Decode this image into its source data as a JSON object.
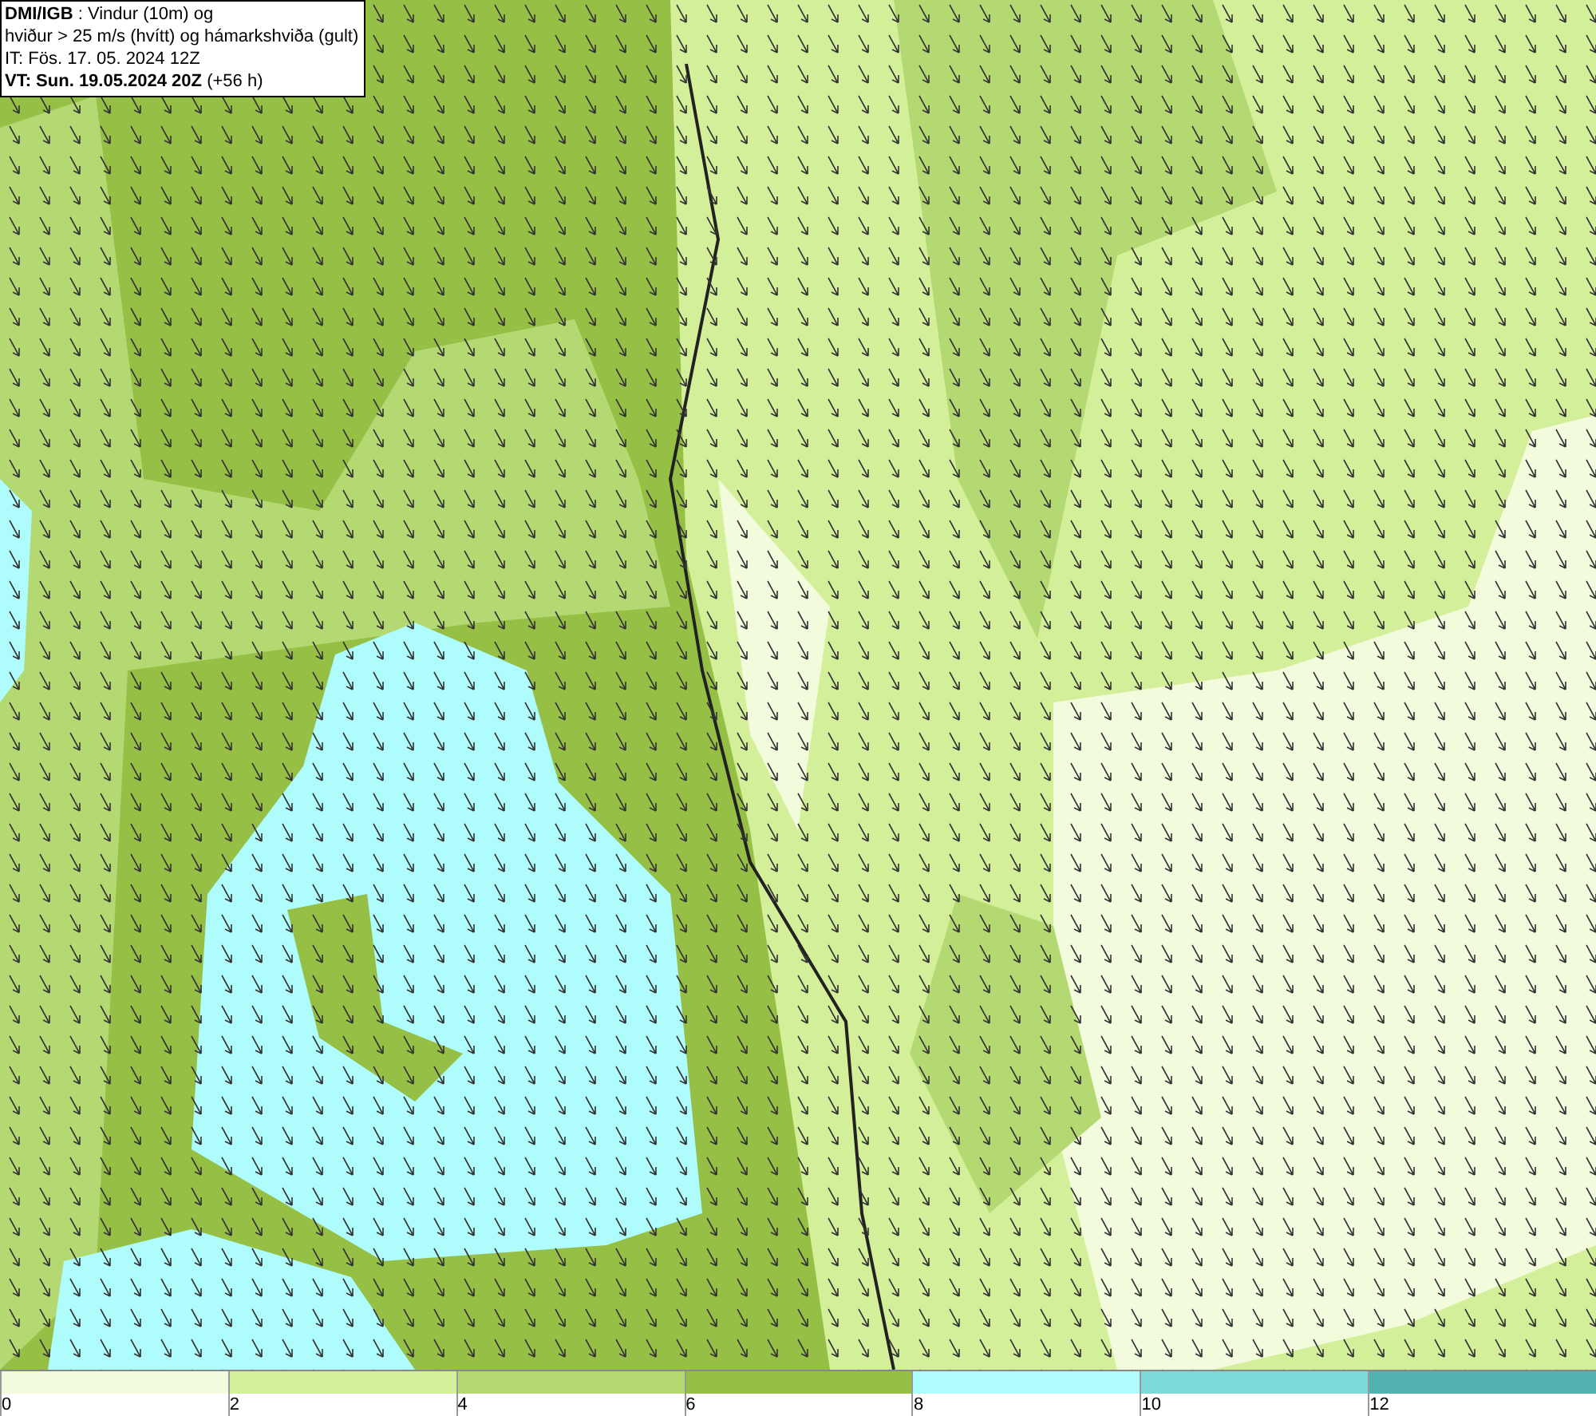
{
  "info_box": {
    "lines": [
      "**DMI/IGB** : Vindur (10m) og",
      "hviður > 25 m/s (hvítt) og hámarkshviða (gult)",
      "IT: Fös. 17. 05. 2024 12Z",
      "**VT: Sun. 19.05.2024 20Z** (+56 h)"
    ]
  },
  "legend": {
    "bins": [
      {
        "label": "0",
        "color": "#f3fbdd"
      },
      {
        "label": "2",
        "color": "#d4ef9a"
      },
      {
        "label": "4",
        "color": "#b5d972"
      },
      {
        "label": "6",
        "color": "#96bf45"
      },
      {
        "label": "8",
        "color": "#aefcfc"
      },
      {
        "label": "10",
        "color": "#7ddada"
      },
      {
        "label": "12",
        "color": "#53b3b3"
      }
    ]
  }
}
